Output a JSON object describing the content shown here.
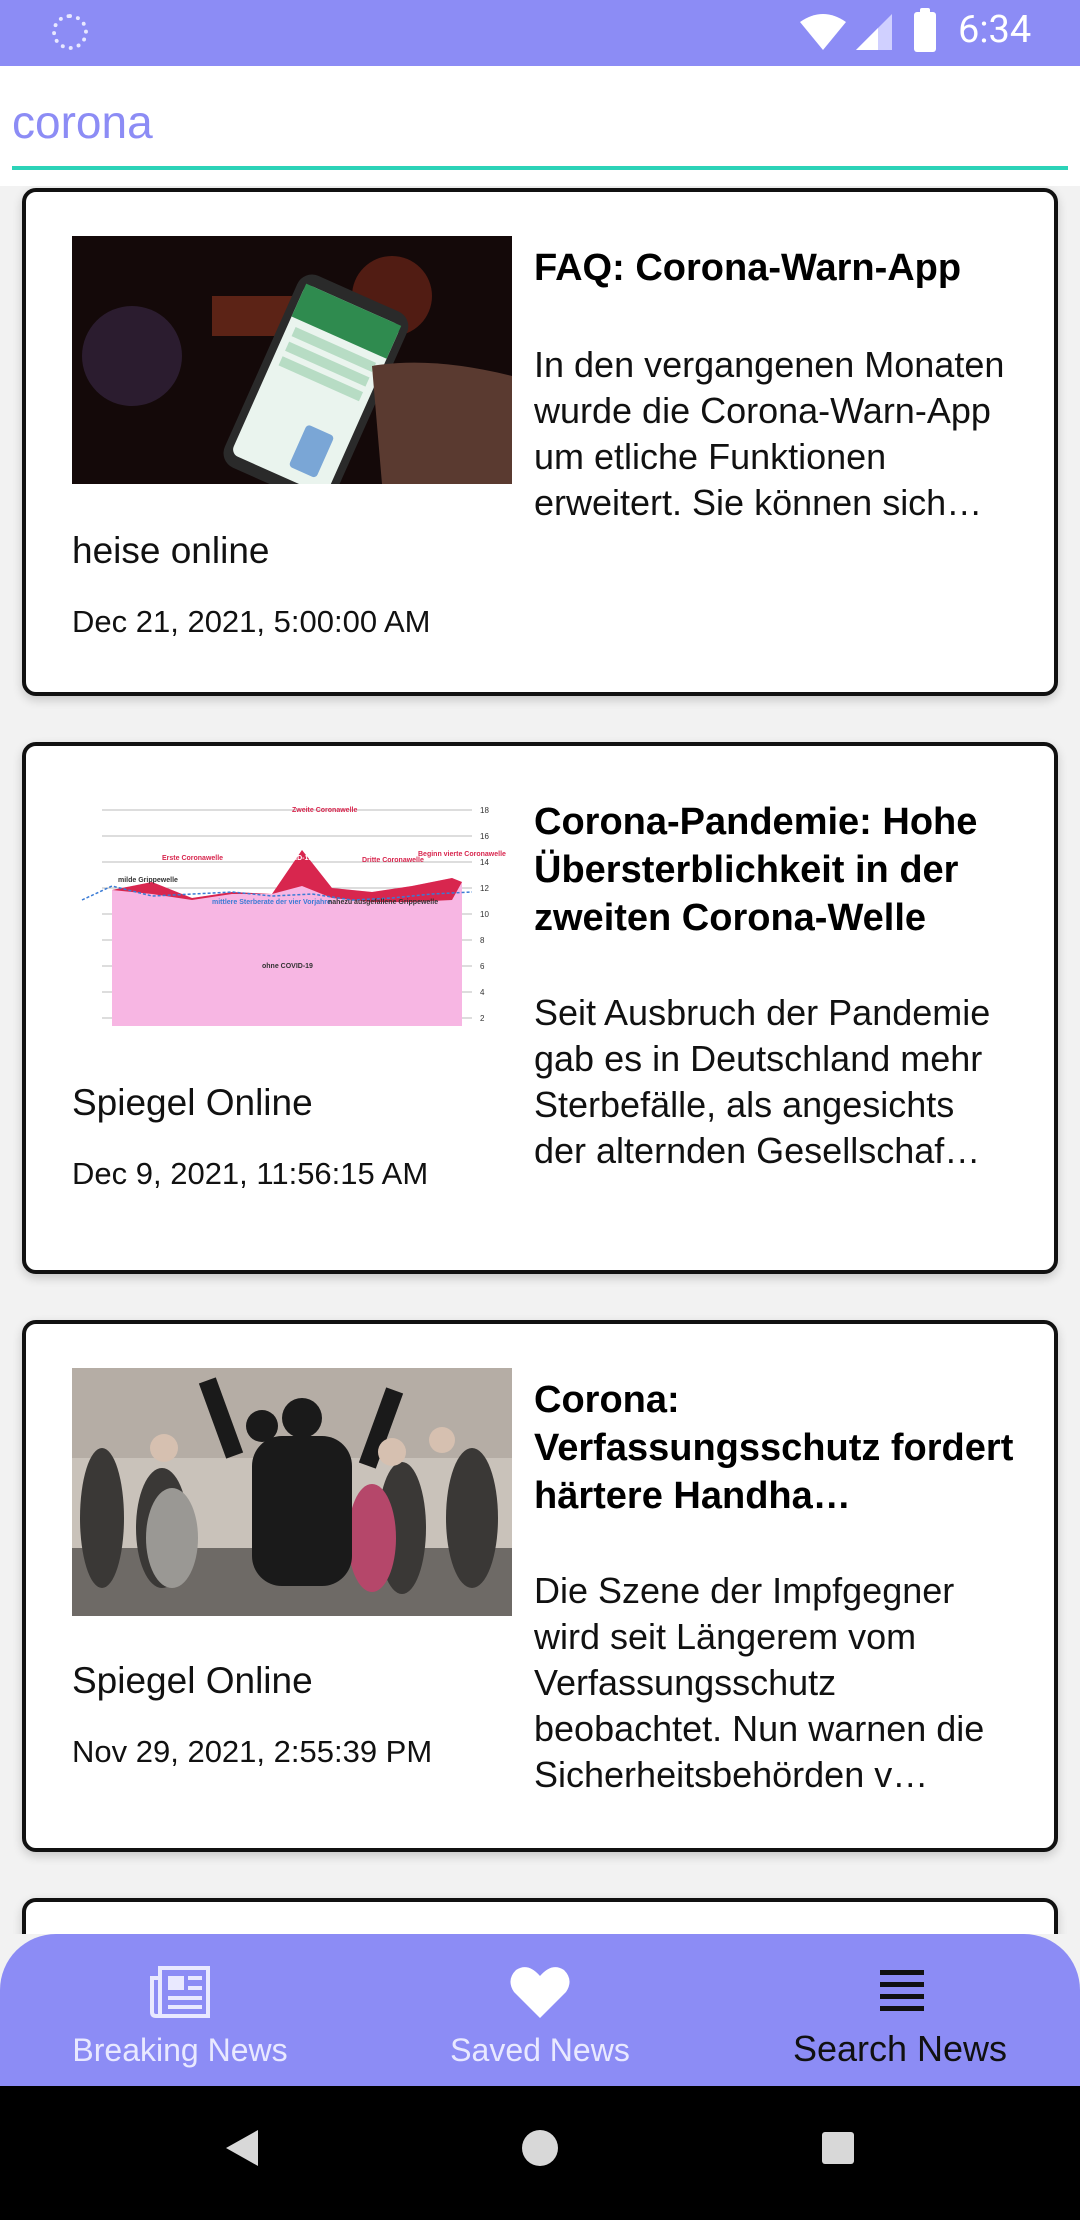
{
  "status_bar": {
    "time": "6:34",
    "icons": [
      "loading-spinner-icon",
      "wifi-icon",
      "cell-signal-icon",
      "battery-icon"
    ]
  },
  "search": {
    "query": "corona",
    "accent_color": "#2cd3b8"
  },
  "articles": [
    {
      "title": "FAQ: Corona-Warn-App",
      "description": "In den vergangenen Monaten wurde die Corona-Warn-App um etliche Funktionen erweitert. Sie können sich…",
      "source": "heise online",
      "date": "Dec 21, 2021, 5:00:00 AM"
    },
    {
      "title": "Corona-Pandemie: Hohe Übersterblichkeit in der zweiten Corona-Welle",
      "description": "Seit Ausbruch der Pandemie gab es in Deutschland mehr Sterbefälle, als angesichts der alternden Gesellschaf…",
      "source": "Spiegel Online",
      "date": "Dec 9, 2021, 11:56:15 AM"
    },
    {
      "title": "Corona: Verfassungsschutz fordert härtere Handha…",
      "description": "Die Szene der Impfgegner wird seit Längerem vom Verfassungsschutz beobachtet. Nun warnen die Sicherheitsbehörden v…",
      "source": "Spiegel Online",
      "date": "Nov 29, 2021, 2:55:39 PM"
    }
  ],
  "thumbnail_chart": {
    "labels": [
      "Zweite Coronawelle",
      "COVID-19",
      "Erste Coronawelle",
      "Dritte Coronawelle",
      "Beginn vierte Coronawelle",
      "milde Grippewelle",
      "mittlere Sterberate der vier Vorjahre",
      "nahezu ausgefallene Grippewelle",
      "ohne COVID-19"
    ],
    "axis": [
      "18",
      "16",
      "14",
      "12",
      "10",
      "8",
      "6",
      "4",
      "2"
    ]
  },
  "bottom_nav": {
    "items": [
      {
        "label": "Breaking News",
        "icon": "newspaper-icon",
        "active": false
      },
      {
        "label": "Saved News",
        "icon": "heart-icon",
        "active": false
      },
      {
        "label": "Search News",
        "icon": "list-icon",
        "active": true
      }
    ],
    "background_color": "#8c8cf5"
  },
  "system_nav": {
    "buttons": [
      "back-icon",
      "home-icon",
      "recents-icon"
    ]
  }
}
